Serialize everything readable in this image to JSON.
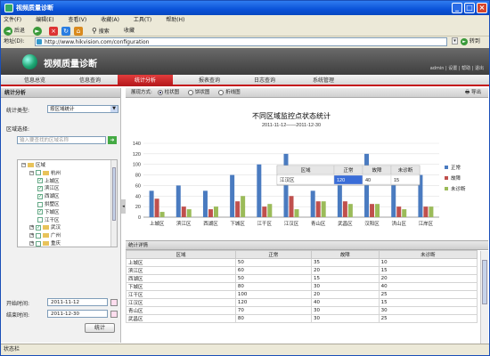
{
  "window": {
    "title": "视频质量诊断"
  },
  "menu": [
    "文件(F)",
    "编辑(E)",
    "查看(V)",
    "收藏(A)",
    "工具(T)",
    "帮助(H)"
  ],
  "nav": {
    "back": "后退",
    "search": "搜索",
    "favorites": "收藏"
  },
  "address": {
    "label": "地址(D):",
    "url": "http://www.hikvision.com/configuration",
    "go": "转到"
  },
  "app": {
    "title": "视频质量诊断",
    "links": "admin | 设置 | 帮助 | 退出"
  },
  "tabs": [
    "信息总览",
    "信息查询",
    "统计分析",
    "报表查询",
    "日志查询",
    "系统管理"
  ],
  "left": {
    "panel_title": "统计分析",
    "type_label": "统计类型:",
    "type_value": "按区域统计",
    "region_label": "区域选择:",
    "region_placeholder": "输入要查找的区域名称",
    "tree": [
      {
        "label": "区域",
        "level": 0,
        "toggle": "−",
        "check": "",
        "folder": true
      },
      {
        "label": "杭州",
        "level": 1,
        "toggle": "−",
        "check": "☐",
        "folder": true
      },
      {
        "label": "上城区",
        "level": 2,
        "toggle": "",
        "check": "✓",
        "folder": false
      },
      {
        "label": "滨江区",
        "level": 2,
        "toggle": "",
        "check": "✓",
        "folder": false
      },
      {
        "label": "西湖区",
        "level": 2,
        "toggle": "",
        "check": "✓",
        "folder": false
      },
      {
        "label": "拱墅区",
        "level": 2,
        "toggle": "",
        "check": "☐",
        "folder": false
      },
      {
        "label": "下城区",
        "level": 2,
        "toggle": "",
        "check": "✓",
        "folder": false
      },
      {
        "label": "江干区",
        "level": 2,
        "toggle": "",
        "check": "☐",
        "folder": false
      },
      {
        "label": "武汉",
        "level": 1,
        "toggle": "+",
        "check": "✓",
        "folder": true
      },
      {
        "label": "广州",
        "level": 1,
        "toggle": "+",
        "check": "☐",
        "folder": true
      },
      {
        "label": "重庆",
        "level": 1,
        "toggle": "+",
        "check": "☐",
        "folder": true
      }
    ],
    "start_label": "开始时间:",
    "start_value": "2011-11-12",
    "end_label": "结束时间:",
    "end_value": "2011-12-30",
    "stat_button": "统计"
  },
  "display": {
    "label": "展现方式:",
    "modes": [
      "柱状图",
      "饼状图",
      "折线图"
    ],
    "selected": 0,
    "export": "导出"
  },
  "chart_data": {
    "type": "bar",
    "title": "不同区域监控点状态统计",
    "subtitle": "2011-11-12——2011-12-30",
    "categories": [
      "上城区",
      "滨江区",
      "西湖区",
      "下城区",
      "江干区",
      "江汉区",
      "青山区",
      "武昌区",
      "汉阳区",
      "洪山区",
      "江岸区"
    ],
    "series": [
      {
        "name": "正常",
        "color": "#4a7bc0",
        "values": [
          50,
          60,
          50,
          80,
          100,
          120,
          50,
          90,
          120,
          70,
          80
        ]
      },
      {
        "name": "故障",
        "color": "#c0504d",
        "values": [
          35,
          20,
          15,
          30,
          20,
          40,
          30,
          30,
          25,
          20,
          20
        ]
      },
      {
        "name": "未诊断",
        "color": "#9bbb59",
        "values": [
          10,
          15,
          20,
          40,
          25,
          15,
          30,
          25,
          25,
          15,
          20
        ]
      }
    ],
    "ylim": [
      0,
      140
    ],
    "yticks": [
      0,
      20,
      40,
      60,
      80,
      100,
      120,
      140
    ],
    "legend_position": "right",
    "tooltip": {
      "headers": [
        "区域",
        "正常",
        "故障",
        "未诊断"
      ],
      "values": [
        "江汉区",
        "120",
        "40",
        "15"
      ]
    }
  },
  "table": {
    "title": "统计详情",
    "headers": [
      "区域",
      "正常",
      "故障",
      "未诊断"
    ],
    "rows": [
      [
        "上城区",
        "50",
        "35",
        "10"
      ],
      [
        "滨江区",
        "60",
        "20",
        "15"
      ],
      [
        "西湖区",
        "50",
        "15",
        "20"
      ],
      [
        "下城区",
        "80",
        "30",
        "40"
      ],
      [
        "江干区",
        "100",
        "20",
        "25"
      ],
      [
        "江汉区",
        "120",
        "40",
        "15"
      ],
      [
        "青山区",
        "70",
        "30",
        "30"
      ],
      [
        "武昌区",
        "80",
        "30",
        "25"
      ]
    ]
  },
  "status": "状态栏"
}
